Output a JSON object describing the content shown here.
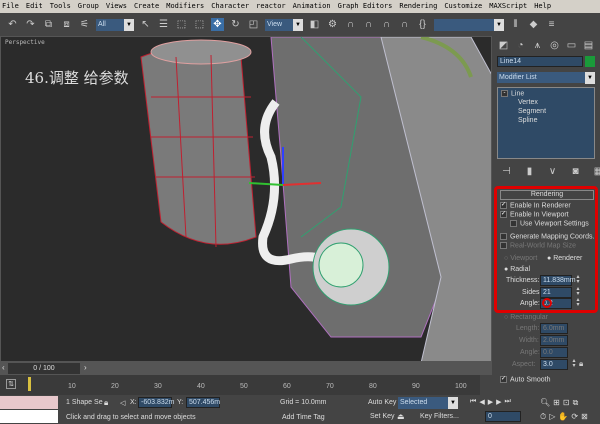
{
  "menu": [
    "File",
    "Edit",
    "Tools",
    "Group",
    "Views",
    "Create",
    "Modifiers",
    "Character",
    "reactor",
    "Animation",
    "Graph Editors",
    "Rendering",
    "Customize",
    "MAXScript",
    "Help"
  ],
  "toolbar": {
    "filter_select": "All",
    "coord_select": "View"
  },
  "viewport": {
    "label": "Perspective",
    "annotation": "46.调整 给参数"
  },
  "command_panel": {
    "object_name": "Line14",
    "object_color": "#1a9a3a",
    "modifier_list": "Modifier List",
    "stack": {
      "root": "Line",
      "subs": [
        "Vertex",
        "Segment",
        "Spline"
      ]
    },
    "rendering": {
      "title": "Rendering",
      "enable_in_renderer": "Enable In Renderer",
      "enable_in_viewport": "Enable In Viewport",
      "use_viewport_settings": "Use Viewport Settings",
      "generate_mapping": "Generate Mapping Coords.",
      "real_world": "Real-World Map Size",
      "viewport": "Viewport",
      "renderer": "Renderer",
      "radial": "Radial",
      "thickness_label": "Thickness:",
      "thickness": "11.838mm",
      "sides_label": "Sides:",
      "sides": "21",
      "angle_label": "Angle:",
      "angle": "0.2",
      "rectangular": "Rectangular",
      "length_label": "Length:",
      "length": "6.0mm",
      "width_label": "Width:",
      "width": "2.0mm",
      "rect_angle_label": "Angle:",
      "rect_angle": "0.0",
      "aspect_label": "Aspect:",
      "aspect": "3.0",
      "auto_smooth": "Auto Smooth"
    },
    "highlight_color": "#e00000"
  },
  "timeline": {
    "frame": "0 / 100",
    "ticks": [
      "10",
      "20",
      "30",
      "40",
      "50",
      "60",
      "70",
      "80",
      "90",
      "100"
    ]
  },
  "status": {
    "selection": "1 Shape Se",
    "x_label": "X:",
    "x": "-603.832m",
    "y_label": "Y:",
    "y": "507.456m",
    "grid": "Grid = 10.0mm",
    "prompt": "Click and drag to select and move objects",
    "add_time_tag": "Add Time Tag",
    "auto_key": "Auto Key",
    "key_mode": "Selected",
    "set_key": "Set Key",
    "key_filters": "Key Filters...",
    "current_frame": "0"
  }
}
